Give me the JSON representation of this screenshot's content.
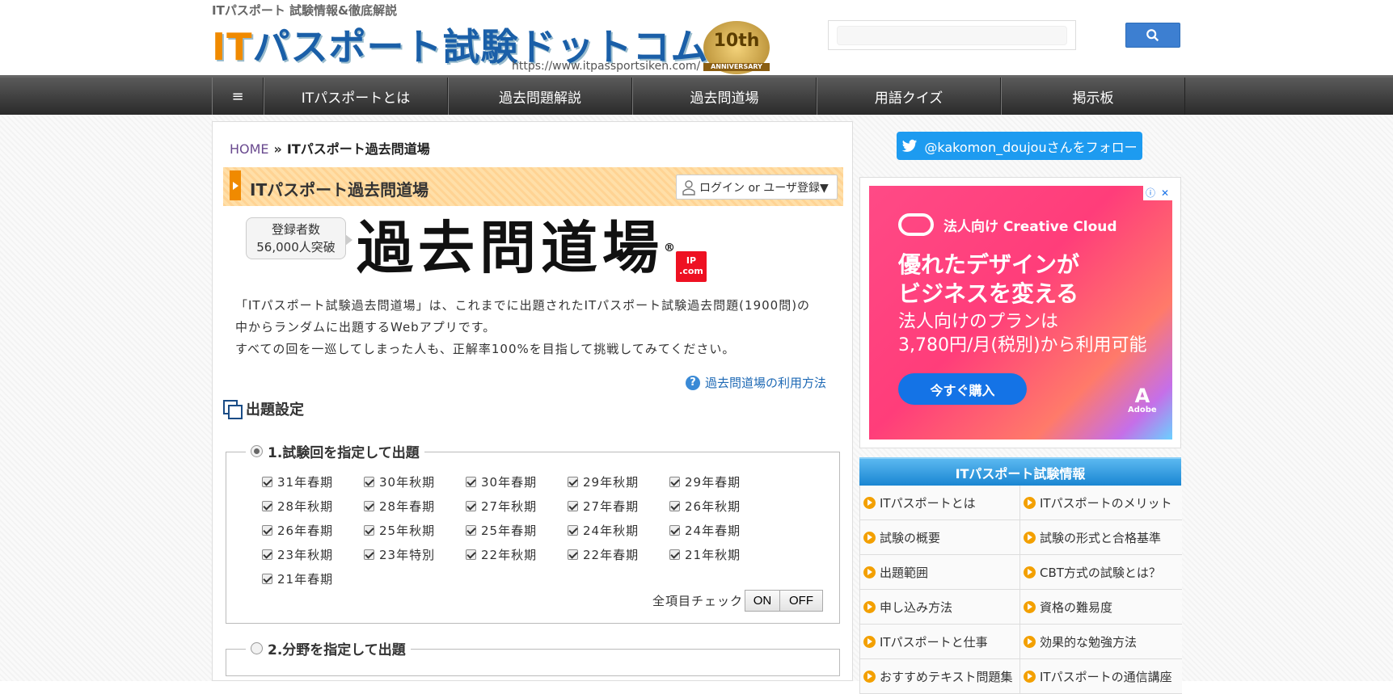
{
  "header": {
    "tagline": "ITパスポート 試験情報&徹底解説",
    "logo_it": "IT",
    "logo_rest": "パスポート試験ドットコム",
    "logo_url": "https://www.itpassportsiken.com/",
    "anniversary_number": "10th",
    "anniversary_label": "ANNIVERSARY",
    "search_placeholder": ""
  },
  "nav": {
    "menu_icon": "≡",
    "items": [
      "ITパスポートとは",
      "過去問題解説",
      "過去問道場",
      "用語クイズ",
      "掲示板"
    ]
  },
  "breadcrumb": {
    "home": "HOME",
    "sep": "»",
    "current": "ITパスポート過去問道場"
  },
  "page": {
    "title": "ITパスポート過去問道場",
    "login_label": "ログイン or ユーザ登録▼",
    "reg_line1": "登録者数",
    "reg_line2": "56,000人突破",
    "dojo_logo": "過去問道場",
    "dojo_reg": "®",
    "stamp_line1": "IP",
    "stamp_line2": ".com",
    "intro_line1": "「ITパスポート試験過去問道場」は、これまでに出題されたITパスポート試験過去問題(1900問)の",
    "intro_line2": "中からランダムに出題するWebアプリです。",
    "intro_line3": "すべての回を一巡してしまった人も、正解率100%を目指して挑戦してみてください。",
    "howto_label": "過去問道場の利用方法",
    "settings_title": "出題設定"
  },
  "section1": {
    "legend": "1.試験回を指定して出題",
    "sessions": [
      "31年春期",
      "30年秋期",
      "30年春期",
      "29年秋期",
      "29年春期",
      "28年秋期",
      "28年春期",
      "27年秋期",
      "27年春期",
      "26年秋期",
      "26年春期",
      "25年秋期",
      "25年春期",
      "24年秋期",
      "24年春期",
      "23年秋期",
      "23年特別",
      "22年秋期",
      "22年春期",
      "21年秋期",
      "21年春期"
    ],
    "all_check_label": "全項目チェック",
    "on_label": "ON",
    "off_label": "OFF"
  },
  "section2": {
    "legend": "2.分野を指定して出題"
  },
  "sidebar": {
    "follow_label": "@kakomon_doujouさんをフォロー",
    "ad": {
      "brand": "法人向け Creative Cloud",
      "head1": "優れたデザインが",
      "head2": "ビジネスを変える",
      "sub1": "法人向けのプランは",
      "sub2": "3,780円/月(税別)から利用可能",
      "buy": "今すぐ購入",
      "adobe": "Adobe",
      "info": "ⓘ",
      "close": "✕"
    },
    "info_title": "ITパスポート試験情報",
    "info_items": [
      "ITパスポートとは",
      "ITパスポートのメリット",
      "試験の概要",
      "試験の形式と合格基準",
      "出題範囲",
      "CBT方式の試験とは？",
      "申し込み方法",
      "資格の難易度",
      "ITパスポートと仕事",
      "効果的な勉強方法",
      "おすすめテキスト問題集",
      "ITパスポートの通信講座"
    ]
  }
}
